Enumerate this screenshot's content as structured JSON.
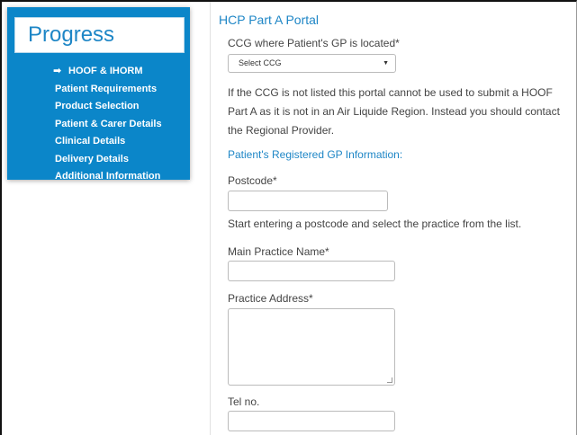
{
  "sidebar": {
    "title": "Progress",
    "items": [
      {
        "label": "HOOF & IHORM",
        "active": true
      },
      {
        "label": "Patient Requirements",
        "active": false
      },
      {
        "label": "Product Selection",
        "active": false
      },
      {
        "label": "Patient & Carer Details",
        "active": false
      },
      {
        "label": "Clinical Details",
        "active": false
      },
      {
        "label": "Delivery Details",
        "active": false
      },
      {
        "label": "Additional Information",
        "active": false
      }
    ]
  },
  "form": {
    "title": "HCP Part A Portal",
    "ccg_label": "CCG where Patient's GP is located*",
    "ccg_select_value": "Select CCG",
    "ccg_note": "If the CCG is not listed this portal cannot be used to submit a HOOF Part A as it is not in an Air Liquide Region. Instead you should contact the Regional Provider.",
    "gp_section_heading": "Patient's Registered GP Information:",
    "postcode_label": "Postcode*",
    "postcode_value": "",
    "postcode_help": "Start entering a postcode and select the practice from the list.",
    "practice_name_label": "Main Practice Name*",
    "practice_name_value": "",
    "practice_address_label": "Practice Address*",
    "practice_address_value": "",
    "tel_label": "Tel no.",
    "tel_value": ""
  },
  "colors": {
    "sidebar_bg": "#0b86c9",
    "accent": "#1e86c6"
  }
}
